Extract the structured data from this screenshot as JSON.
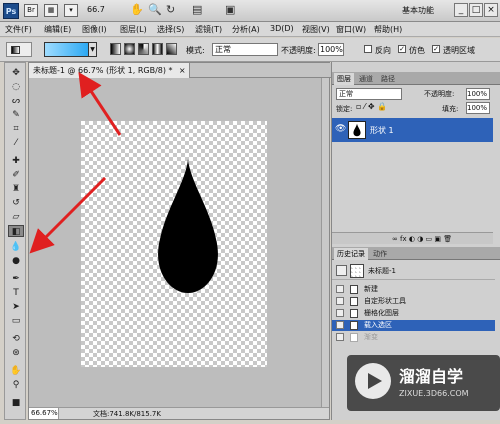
{
  "app": {
    "logo_text": "Ps",
    "zoom": "66.7",
    "workspace": "基本功能",
    "window_controls": [
      "_",
      "□",
      "×"
    ]
  },
  "menu": [
    "文件(F)",
    "编辑(E)",
    "图像(I)",
    "图层(L)",
    "选择(S)",
    "滤镜(T)",
    "分析(A)",
    "3D(D)",
    "视图(V)",
    "窗口(W)",
    "帮助(H)"
  ],
  "options": {
    "mode_label": "模式:",
    "mode_value": "正常",
    "opacity_label": "不透明度:",
    "opacity_value": "100%",
    "reverse_label": "反向",
    "dither_label": "仿色",
    "transparency_label": "透明区域",
    "gradient_colors": [
      "#9fdcff",
      "#1aa0f0"
    ]
  },
  "document": {
    "tab_title": "未标题-1 @ 66.7% (形状 1, RGB/8) *",
    "close": "×",
    "zoom_status": "66.67%",
    "doc_info": "文档:741.8K/815.7K"
  },
  "layers_panel": {
    "tabs": [
      "图层",
      "通道",
      "路径"
    ],
    "blend_mode": "正常",
    "opacity_label": "不透明度:",
    "opacity_value": "100%",
    "lock_label": "锁定:",
    "fill_label": "填充:",
    "fill_value": "100%",
    "layer_name": "形状 1"
  },
  "history_panel": {
    "tabs": [
      "历史记录",
      "动作"
    ],
    "snapshot_name": "未标题-1",
    "items": [
      {
        "label": "新建",
        "state": "normal"
      },
      {
        "label": "自定形状工具",
        "state": "normal"
      },
      {
        "label": "栅格化图层",
        "state": "normal"
      },
      {
        "label": "载入选区",
        "state": "selected"
      },
      {
        "label": "渐变",
        "state": "dimmed"
      }
    ]
  },
  "watermark": {
    "title": "溜溜自学",
    "url": "ZIXUE.3D66.COM"
  },
  "colors": {
    "selection_blue": "#2e62b8",
    "annotation_arrow": "#e02020"
  }
}
